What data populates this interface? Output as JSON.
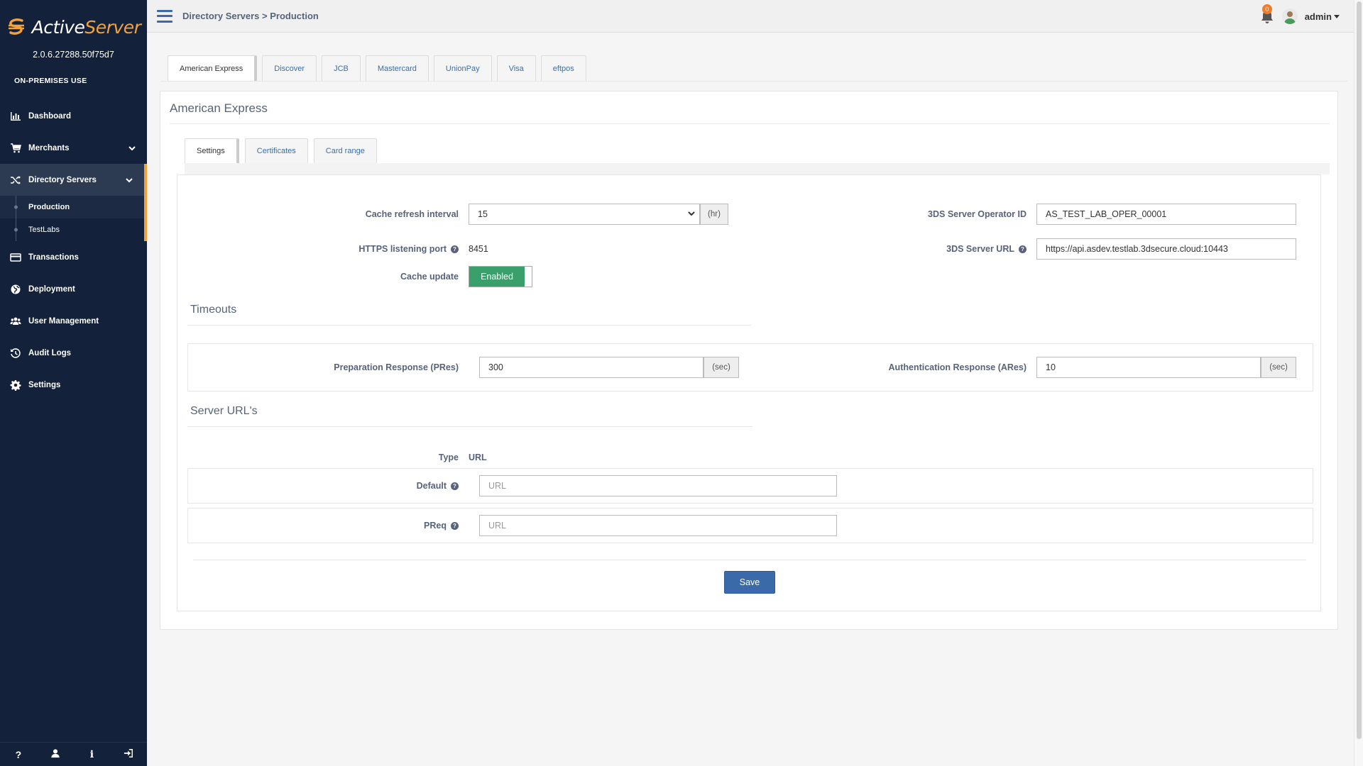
{
  "app": {
    "brand_part1": "Active",
    "brand_part2": "Server",
    "version": "2.0.6.27288.50f75d7",
    "usage": "ON-PREMISES USE"
  },
  "sidebar": {
    "items": [
      {
        "label": "Dashboard",
        "icon": "bar-chart-icon"
      },
      {
        "label": "Merchants",
        "icon": "cart-icon"
      },
      {
        "label": "Directory Servers",
        "icon": "shuffle-icon"
      },
      {
        "label": "Transactions",
        "icon": "credit-card-icon"
      },
      {
        "label": "Deployment",
        "icon": "globe-icon"
      },
      {
        "label": "User Management",
        "icon": "users-icon"
      },
      {
        "label": "Audit Logs",
        "icon": "history-icon"
      },
      {
        "label": "Settings",
        "icon": "gear-icon"
      }
    ],
    "sub_items": [
      {
        "label": "Production"
      },
      {
        "label": "TestLabs"
      }
    ],
    "footer": {
      "help": "?",
      "info": "i"
    }
  },
  "topbar": {
    "breadcrumb": "Directory Servers > Production",
    "notification_count": "0",
    "user": "admin"
  },
  "ds_tabs": [
    "American Express",
    "Discover",
    "JCB",
    "Mastercard",
    "UnionPay",
    "Visa",
    "eftpos"
  ],
  "card": {
    "title": "American Express",
    "tabs": [
      "Settings",
      "Certificates",
      "Card range"
    ]
  },
  "settings": {
    "cache_refresh_label": "Cache refresh interval",
    "cache_refresh_value": "15",
    "cache_refresh_unit": "(hr)",
    "https_port_label": "HTTPS listening port",
    "https_port_value": "8451",
    "cache_update_label": "Cache update",
    "cache_update_value": "Enabled",
    "operator_id_label": "3DS Server Operator ID",
    "operator_id_value": "AS_TEST_LAB_OPER_00001",
    "server_url_label": "3DS Server URL",
    "server_url_value": "https://api.asdev.testlab.3dsecure.cloud:10443"
  },
  "timeouts": {
    "title": "Timeouts",
    "preq_label": "Preparation Response (PRes)",
    "preq_value": "300",
    "preq_unit": "(sec)",
    "areq_label": "Authentication Response (ARes)",
    "areq_value": "10",
    "areq_unit": "(sec)"
  },
  "server_urls": {
    "title": "Server URL's",
    "type_header": "Type",
    "url_header": "URL",
    "default_label": "Default",
    "default_placeholder": "URL",
    "preq_label": "PReq",
    "preq_placeholder": "URL"
  },
  "actions": {
    "save": "Save"
  },
  "colors": {
    "sidebar_bg": "#13213a",
    "accent": "#f0a33a",
    "primary": "#3a6aa8",
    "success": "#3aa06b"
  }
}
